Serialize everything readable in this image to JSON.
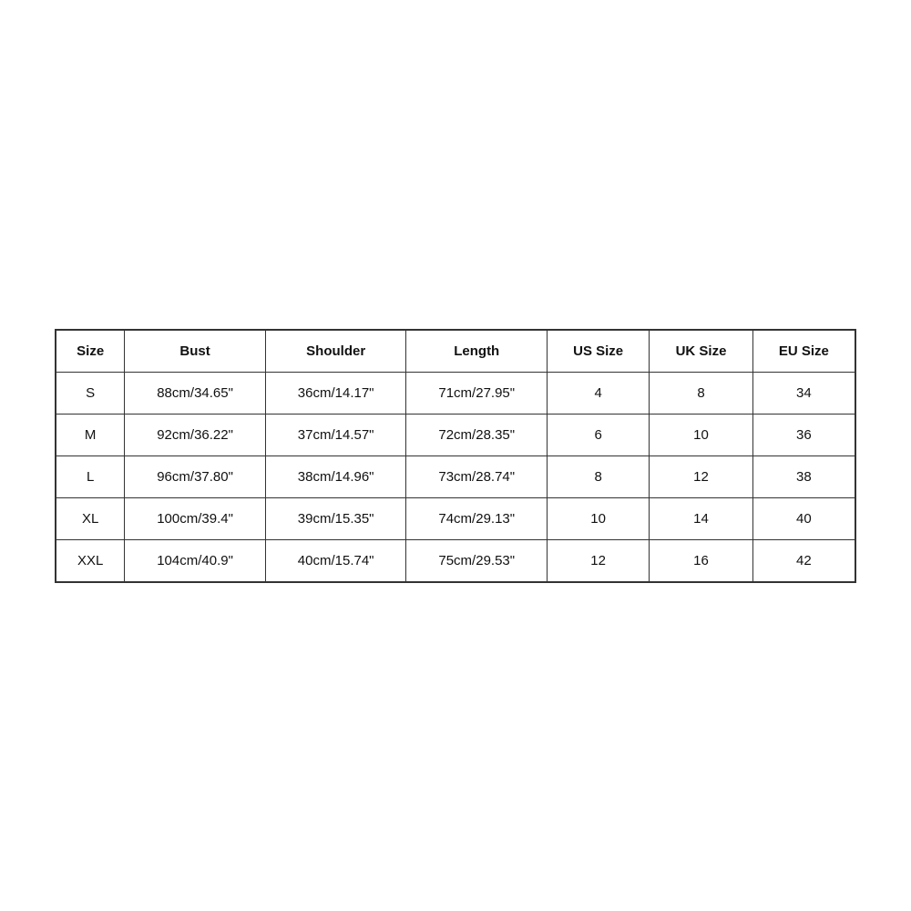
{
  "table": {
    "headers": [
      "Size",
      "Bust",
      "Shoulder",
      "Length",
      "US Size",
      "UK Size",
      "EU Size"
    ],
    "rows": [
      {
        "size": "S",
        "bust": "88cm/34.65\"",
        "shoulder": "36cm/14.17\"",
        "length": "71cm/27.95\"",
        "us_size": "4",
        "uk_size": "8",
        "eu_size": "34"
      },
      {
        "size": "M",
        "bust": "92cm/36.22\"",
        "shoulder": "37cm/14.57\"",
        "length": "72cm/28.35\"",
        "us_size": "6",
        "uk_size": "10",
        "eu_size": "36"
      },
      {
        "size": "L",
        "bust": "96cm/37.80\"",
        "shoulder": "38cm/14.96\"",
        "length": "73cm/28.74\"",
        "us_size": "8",
        "uk_size": "12",
        "eu_size": "38"
      },
      {
        "size": "XL",
        "bust": "100cm/39.4\"",
        "shoulder": "39cm/15.35\"",
        "length": "74cm/29.13\"",
        "us_size": "10",
        "uk_size": "14",
        "eu_size": "40"
      },
      {
        "size": "XXL",
        "bust": "104cm/40.9\"",
        "shoulder": "40cm/15.74\"",
        "length": "75cm/29.53\"",
        "us_size": "12",
        "uk_size": "16",
        "eu_size": "42"
      }
    ]
  }
}
